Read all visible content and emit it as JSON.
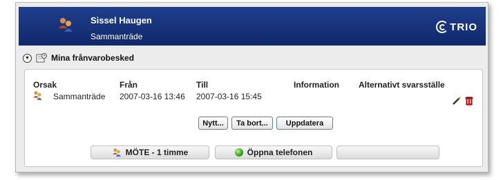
{
  "header": {
    "name": "Sissel Haugen",
    "status": "Sammanträde",
    "logo_text": "TRIO",
    "bg_color": "#14307a"
  },
  "section": {
    "title": "Mina frånvarobesked",
    "toggle_icon": "collapse-arrow-icon",
    "section_icon": "absence-note-icon"
  },
  "table": {
    "columns": [
      "Orsak",
      "Från",
      "Till",
      "Information",
      "Alternativt svarsställe"
    ],
    "rows": [
      {
        "icon": "group-icon",
        "orsak": "Sammanträde",
        "fran": "2007-03-16 13:46",
        "till": "2007-03-16 15:45",
        "information": "",
        "alternativt": "",
        "actions": [
          "edit-icon",
          "delete-icon"
        ]
      }
    ]
  },
  "buttons": {
    "new": "Nytt...",
    "delete": "Ta bort...",
    "update": "Uppdatera"
  },
  "bottom_bar": {
    "meeting": "MÖTE - 1 timme",
    "open_phone": "Öppna telefonen",
    "empty": ""
  }
}
